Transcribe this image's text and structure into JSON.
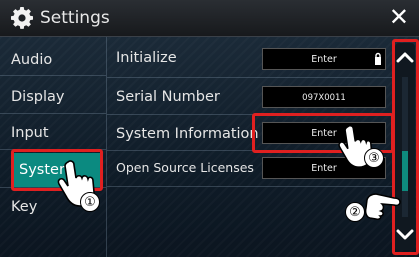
{
  "header": {
    "title": "Settings",
    "close_glyph": "✕"
  },
  "sidebar": {
    "items": [
      {
        "label": "Audio"
      },
      {
        "label": "Display"
      },
      {
        "label": "Input"
      },
      {
        "label": "System",
        "active": true
      },
      {
        "label": "Key"
      }
    ]
  },
  "rows": [
    {
      "label": "Initialize",
      "button": "Enter"
    },
    {
      "label": "Serial Number",
      "value": "097X0011"
    },
    {
      "label": "System Information",
      "button": "Enter"
    },
    {
      "label": "Open Source Licenses",
      "button": "Enter"
    }
  ],
  "markers": {
    "one": "①",
    "two": "②",
    "three": "③"
  },
  "colors": {
    "accent": "#0b8a80",
    "highlight": "#e02020"
  },
  "icons": [
    "gear-icon",
    "close-icon",
    "lock-icon",
    "chevron-up-icon",
    "chevron-down-icon",
    "hand-pointer-icon"
  ]
}
